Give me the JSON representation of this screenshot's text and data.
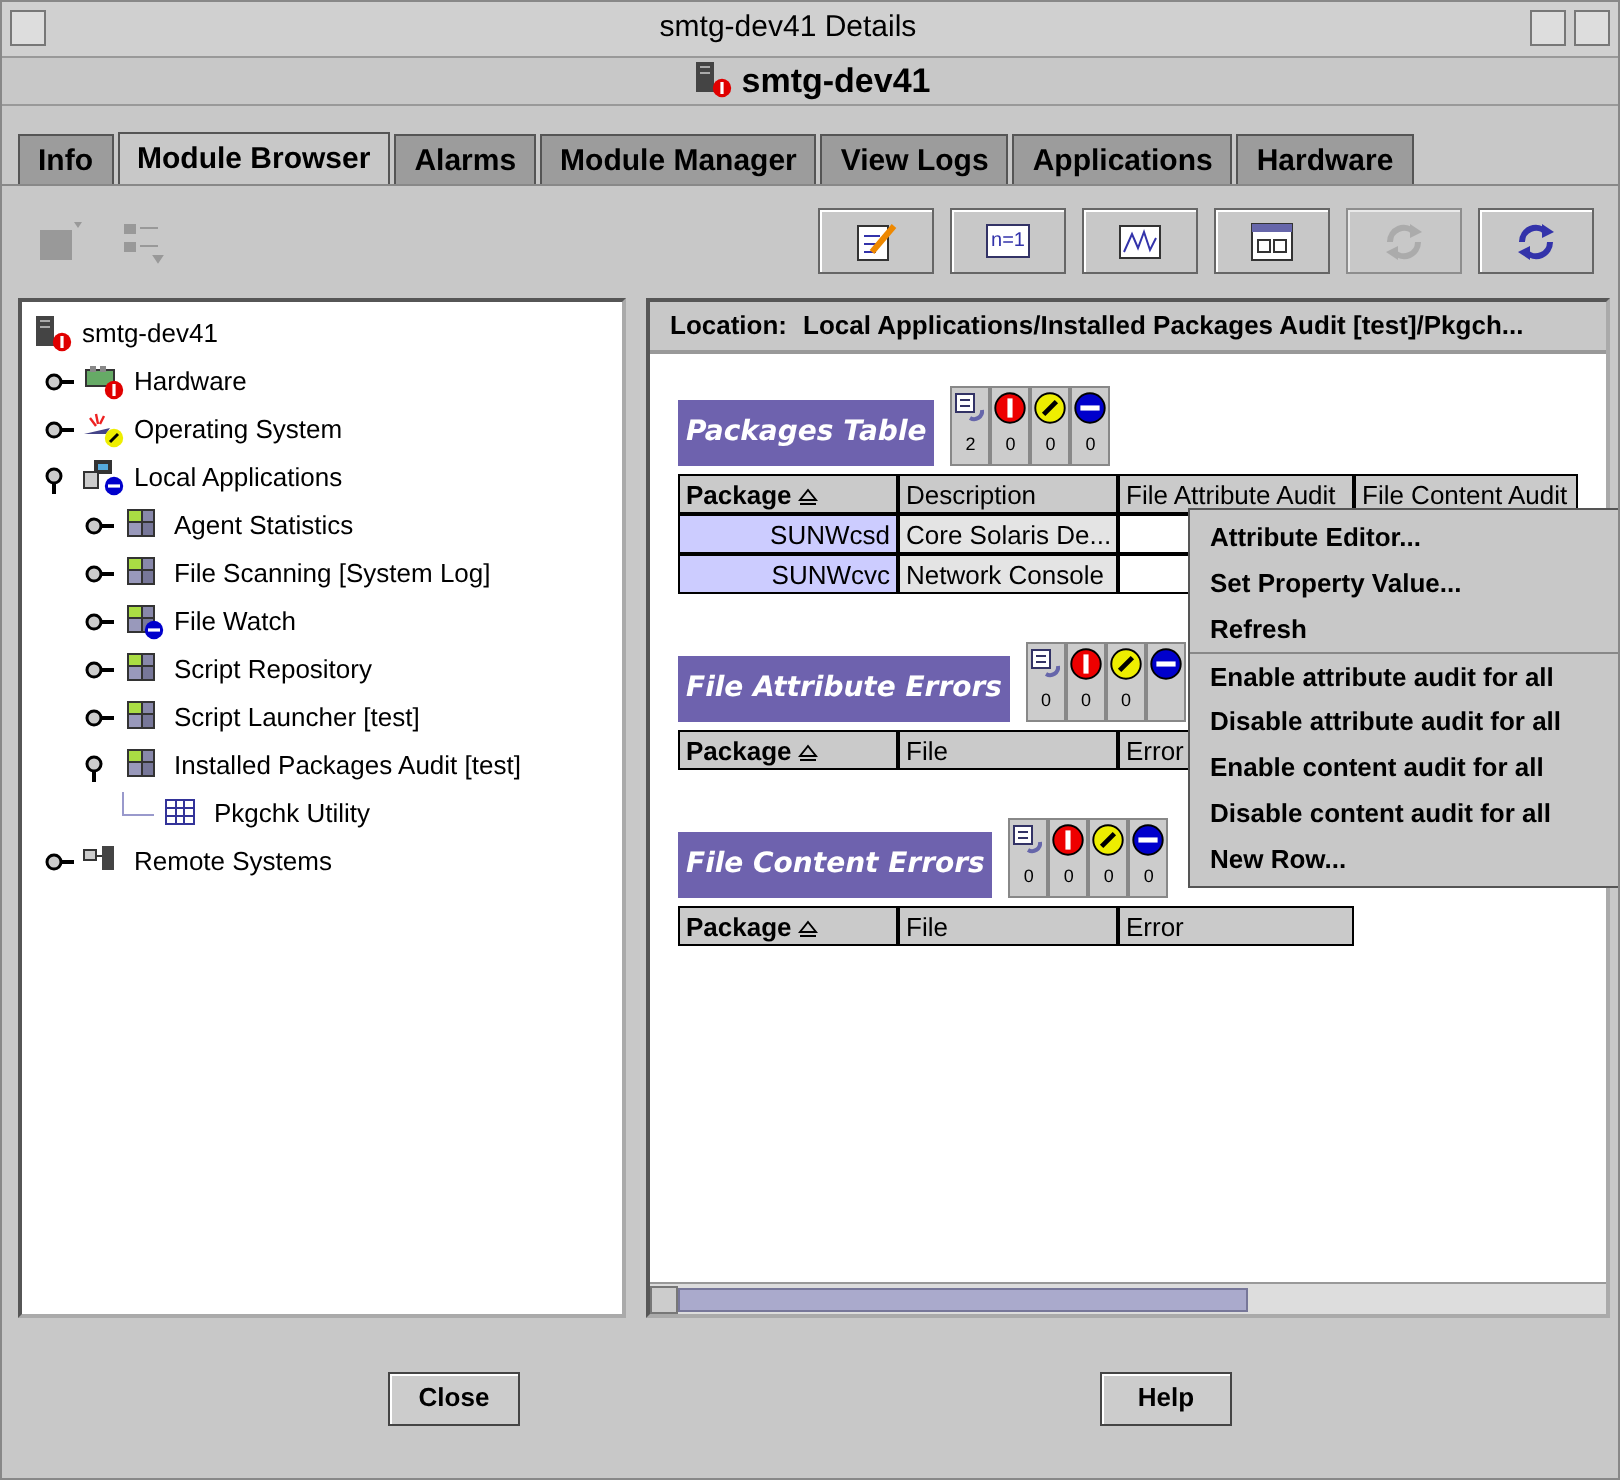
{
  "window": {
    "title": "smtg-dev41 Details"
  },
  "header": {
    "host": "smtg-dev41",
    "color": "#e00000"
  },
  "tabs": [
    {
      "label": "Info",
      "selected": false
    },
    {
      "label": "Module Browser",
      "selected": true
    },
    {
      "label": "Alarms",
      "selected": false
    },
    {
      "label": "Module Manager",
      "selected": false
    },
    {
      "label": "View Logs",
      "selected": false
    },
    {
      "label": "Applications",
      "selected": false
    },
    {
      "label": "Hardware",
      "selected": false
    }
  ],
  "toolbar": {
    "left": [
      {
        "kind": "module",
        "disabled": true
      },
      {
        "kind": "list",
        "disabled": true
      }
    ],
    "right": [
      {
        "kind": "edit",
        "disabled": false
      },
      {
        "kind": "counter",
        "label": "n=1",
        "disabled": false
      },
      {
        "kind": "graph",
        "disabled": false
      },
      {
        "kind": "window",
        "disabled": false
      },
      {
        "kind": "refresh",
        "disabled": true
      },
      {
        "kind": "refresh",
        "disabled": false
      }
    ]
  },
  "tree": {
    "label": "smtg-dev41",
    "kind": "host",
    "color": "#e00000",
    "children": [
      {
        "label": "Hardware",
        "kind": "hardware",
        "color": "#e00000",
        "expanded": false
      },
      {
        "label": "Operating System",
        "kind": "os",
        "color": "#eeee00",
        "expanded": false
      },
      {
        "label": "Local Applications",
        "kind": "apps",
        "color": "#0000cc",
        "expanded": true,
        "children": [
          {
            "label": "Agent Statistics",
            "kind": "module",
            "expanded": false
          },
          {
            "label": "File Scanning [System Log]",
            "kind": "module",
            "expanded": false
          },
          {
            "label": "File Watch",
            "kind": "module",
            "color": "#0000cc",
            "expanded": false
          },
          {
            "label": "Script Repository",
            "kind": "module",
            "expanded": false
          },
          {
            "label": "Script Launcher [test]",
            "kind": "module",
            "expanded": false
          },
          {
            "label": "Installed Packages Audit [test]",
            "kind": "module",
            "expanded": true,
            "children": [
              {
                "label": "Pkgchk Utility",
                "kind": "table"
              }
            ]
          }
        ]
      },
      {
        "label": "Remote Systems",
        "kind": "remote",
        "expanded": false
      }
    ]
  },
  "location": {
    "label": "Location:",
    "path": "Local Applications/Installed Packages Audit [test]/Pkgch..."
  },
  "sections": [
    {
      "title": "Packages Table",
      "counts": [
        {
          "kind": "refresh",
          "count": "2"
        },
        {
          "kind": "critical",
          "count": "0"
        },
        {
          "kind": "warning",
          "count": "0"
        },
        {
          "kind": "disabled",
          "count": "0"
        }
      ],
      "columns": [
        {
          "label": "Package",
          "sorted": true
        },
        {
          "label": "Description",
          "sorted": false
        },
        {
          "label": "File Attribute Audit",
          "sorted": false
        },
        {
          "label": "File Content Audit",
          "sorted": false
        }
      ],
      "rows": [
        {
          "cells": [
            "SUNWcsd",
            "Core Solaris De..."
          ]
        },
        {
          "cells": [
            "SUNWcvc",
            "Network Console"
          ]
        }
      ]
    },
    {
      "title": "File Attribute Errors",
      "counts": [
        {
          "kind": "refresh",
          "count": "0"
        },
        {
          "kind": "critical",
          "count": "0"
        },
        {
          "kind": "warning",
          "count": "0"
        },
        {
          "kind": "disabled"
        }
      ],
      "columns": [
        {
          "label": "Package",
          "sorted": true
        },
        {
          "label": "File",
          "sorted": false
        },
        {
          "label": "Error",
          "sorted": false
        }
      ]
    },
    {
      "title": "File Content Errors",
      "counts": [
        {
          "kind": "refresh",
          "count": "0"
        },
        {
          "kind": "critical",
          "count": "0"
        },
        {
          "kind": "warning",
          "count": "0"
        },
        {
          "kind": "disabled",
          "count": "0"
        }
      ],
      "columns": [
        {
          "label": "Package",
          "sorted": true
        },
        {
          "label": "File",
          "sorted": false
        },
        {
          "label": "Error",
          "sorted": false
        }
      ]
    }
  ],
  "context_menu": [
    {
      "label": "Attribute Editor...",
      "separator_before": false
    },
    {
      "label": "Set Property Value...",
      "separator_before": false
    },
    {
      "label": "Refresh",
      "separator_before": false
    },
    {
      "label": "Enable attribute audit for all",
      "separator_before": true
    },
    {
      "label": "Disable attribute audit for all",
      "separator_before": false
    },
    {
      "label": "Enable content audit for all",
      "separator_before": false
    },
    {
      "label": "Disable content audit for all",
      "separator_before": false
    },
    {
      "label": "New Row...",
      "separator_before": false
    }
  ],
  "buttons": [
    "Close",
    "Help"
  ]
}
